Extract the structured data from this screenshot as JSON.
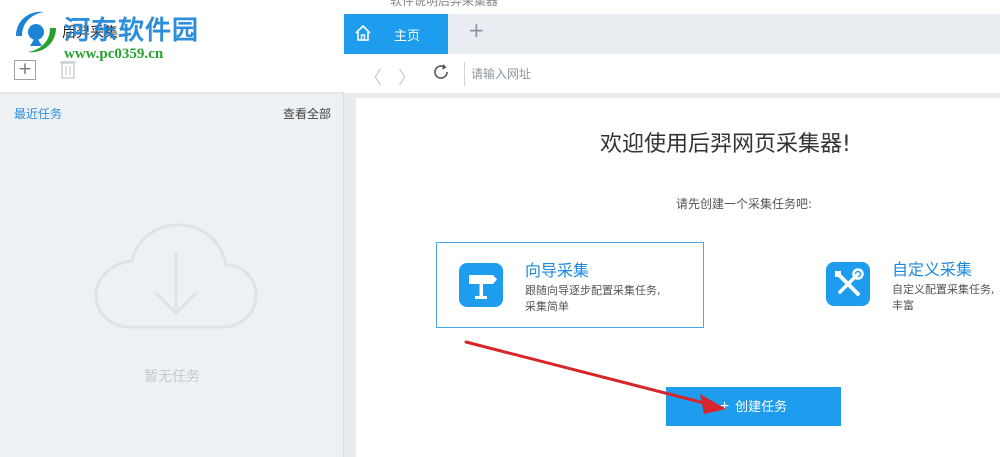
{
  "watermark": {
    "title": "河东软件园",
    "url": "www.pc0359.cn",
    "top_text": "软件说明后羿采集器"
  },
  "app": {
    "title": "后羿采集"
  },
  "sidebar": {
    "recent_label": "最近任务",
    "view_all": "查看全部",
    "empty_text": "暂无任务"
  },
  "tabs": [
    {
      "label": "主页",
      "icon": "home-icon",
      "active": true
    }
  ],
  "tab_add_symbol": "+",
  "nav": {
    "back_symbol": "〈",
    "forward_symbol": "〉",
    "url_placeholder": "请输入网址"
  },
  "main": {
    "welcome": "欢迎使用后羿网页采集器!",
    "subtitle": "请先创建一个采集任务吧:",
    "cards": [
      {
        "title": "向导采集",
        "desc_line1": "跟随向导逐步配置采集任务,",
        "desc_line2": "采集简单",
        "icon": "signpost-icon"
      },
      {
        "title": "自定义采集",
        "desc_line1": "自定义配置采集任务,",
        "desc_line2": "丰富",
        "icon": "tools-icon"
      }
    ],
    "create_button_plus": "+",
    "create_button_label": "创建任务"
  },
  "colors": {
    "accent": "#1e9cee",
    "link_blue": "#2a8fe0",
    "annotation_arrow": "#d7262b"
  }
}
